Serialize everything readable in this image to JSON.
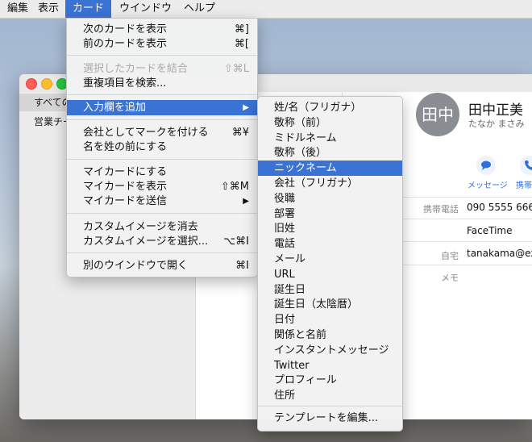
{
  "menubar": {
    "items": [
      "編集",
      "表示",
      "カード",
      "ウインドウ",
      "ヘルプ"
    ]
  },
  "sidebar": {
    "items": [
      "すべての",
      "営業チー"
    ]
  },
  "contact": {
    "avatar_initials": "田中",
    "name": "田中正美",
    "kana": "たなか まさみ",
    "actions": [
      "メッセージ",
      "携帯"
    ],
    "fields": [
      {
        "label": "携帯電話",
        "value": "090 5555 666"
      },
      {
        "label": "",
        "value": "FaceTime"
      },
      {
        "label": "自宅",
        "value": "tanakama@exa"
      },
      {
        "label": "メモ",
        "value": ""
      }
    ]
  },
  "card_menu": {
    "groups": [
      [
        {
          "label": "次のカードを表示",
          "shortcut": "⌘]"
        },
        {
          "label": "前のカードを表示",
          "shortcut": "⌘["
        }
      ],
      [
        {
          "label": "選択したカードを結合",
          "shortcut": "⇧⌘L",
          "disabled": true
        },
        {
          "label": "重複項目を検索...",
          "shortcut": ""
        }
      ],
      [
        {
          "label": "入力欄を追加",
          "shortcut": "▶",
          "highlighted": true
        }
      ],
      [
        {
          "label": "会社としてマークを付ける",
          "shortcut": "⌘¥"
        },
        {
          "label": "名を姓の前にする",
          "shortcut": ""
        }
      ],
      [
        {
          "label": "マイカードにする",
          "shortcut": ""
        },
        {
          "label": "マイカードを表示",
          "shortcut": "⇧⌘M"
        },
        {
          "label": "マイカードを送信",
          "shortcut": "▶"
        }
      ],
      [
        {
          "label": "カスタムイメージを消去",
          "shortcut": ""
        },
        {
          "label": "カスタムイメージを選択...",
          "shortcut": "⌥⌘I"
        }
      ],
      [
        {
          "label": "別のウインドウで開く",
          "shortcut": "⌘I"
        }
      ]
    ]
  },
  "sub_menu": {
    "items": [
      "姓/名（フリガナ）",
      "敬称（前）",
      "ミドルネーム",
      "敬称（後）",
      "ニックネーム",
      "会社（フリガナ）",
      "役職",
      "部署",
      "旧姓",
      "電話",
      "メール",
      "URL",
      "誕生日",
      "誕生日（太陰暦）",
      "日付",
      "関係と名前",
      "インスタントメッセージ",
      "Twitter",
      "プロフィール",
      "住所"
    ],
    "highlighted_index": 4,
    "footer": "テンプレートを編集..."
  },
  "colors": {
    "highlight": "#3b73d5",
    "avatar": "#8a8d93",
    "action_blue": "#2f6fd8"
  }
}
